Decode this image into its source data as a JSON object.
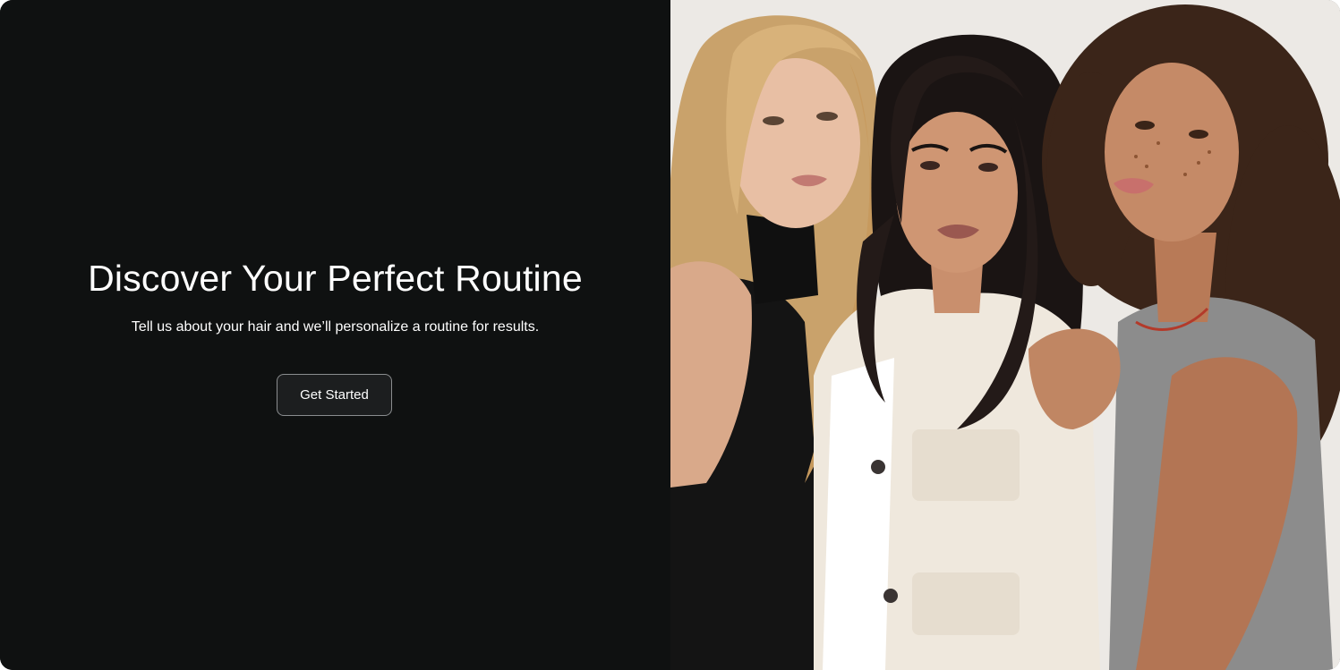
{
  "hero": {
    "headline": "Discover Your Perfect Routine",
    "subheadline": "Tell us about your hair and we’ll personalize a routine for results.",
    "cta_label": "Get Started"
  },
  "colors": {
    "panel_background": "#0f1111",
    "text": "#ffffff",
    "photo_backdrop": "#ece9e5"
  }
}
